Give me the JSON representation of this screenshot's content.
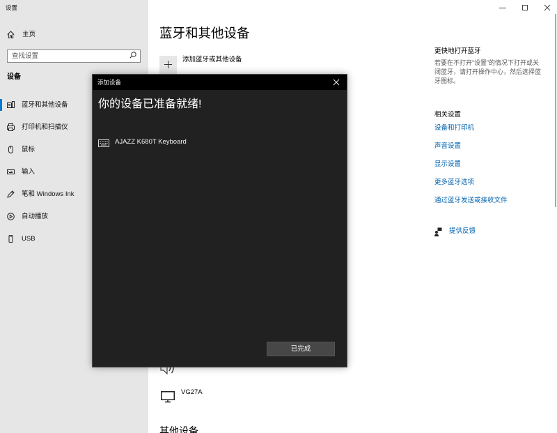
{
  "window": {
    "title": "设置",
    "controls": [
      "minimize-icon",
      "maximize-icon",
      "close-icon"
    ]
  },
  "sidebar": {
    "home": {
      "label": "主页",
      "icon": "home-icon"
    },
    "search": {
      "placeholder": "查找设置",
      "icon": "search-icon"
    },
    "section_title": "设备",
    "items": [
      {
        "label": "蓝牙和其他设备",
        "icon": "devices-icon",
        "selected": true
      },
      {
        "label": "打印机和扫描仪",
        "icon": "printer-icon",
        "selected": false
      },
      {
        "label": "鼠标",
        "icon": "mouse-icon",
        "selected": false
      },
      {
        "label": "输入",
        "icon": "keyboard-icon",
        "selected": false
      },
      {
        "label": "笔和 Windows Ink",
        "icon": "pen-icon",
        "selected": false
      },
      {
        "label": "自动播放",
        "icon": "autoplay-icon",
        "selected": false
      },
      {
        "label": "USB",
        "icon": "usb-icon",
        "selected": false
      }
    ]
  },
  "main": {
    "title": "蓝牙和其他设备",
    "add_device": {
      "label": "添加蓝牙或其他设备",
      "icon": "plus-icon"
    },
    "devices": [
      {
        "icon": "speaker-icon"
      },
      {
        "name": "VG27A",
        "icon": "monitor-icon"
      }
    ],
    "other_devices_heading": "其他设备"
  },
  "right_panel": {
    "quick_bluetooth": {
      "title": "更快地打开蓝牙",
      "description_lines": [
        "若要在不打开“设置”的情况下打开或关",
        "闭蓝牙，请打开操作中心，然后选择蓝",
        "牙图标。"
      ]
    },
    "related_settings": {
      "title": "相关设置",
      "links": [
        "设备和打印机",
        "声音设置",
        "显示设置",
        "更多蓝牙选项",
        "通过蓝牙发送或接收文件"
      ]
    },
    "feedback": {
      "label": "提供反馈",
      "icon": "feedback-icon"
    }
  },
  "dialog": {
    "title": "添加设备",
    "close_icon": "close-icon",
    "heading": "你的设备已准备就绪!",
    "device": {
      "name": "AJAZZ K680T Keyboard",
      "icon": "keyboard-icon"
    },
    "done_button": "已完成"
  },
  "colors": {
    "accent": "#0078d7",
    "link": "#0063b1",
    "sidebar_bg": "#e6e6e6",
    "dialog_bg": "#212121",
    "dialog_titlebar": "#000000",
    "button_bg": "#474747"
  }
}
